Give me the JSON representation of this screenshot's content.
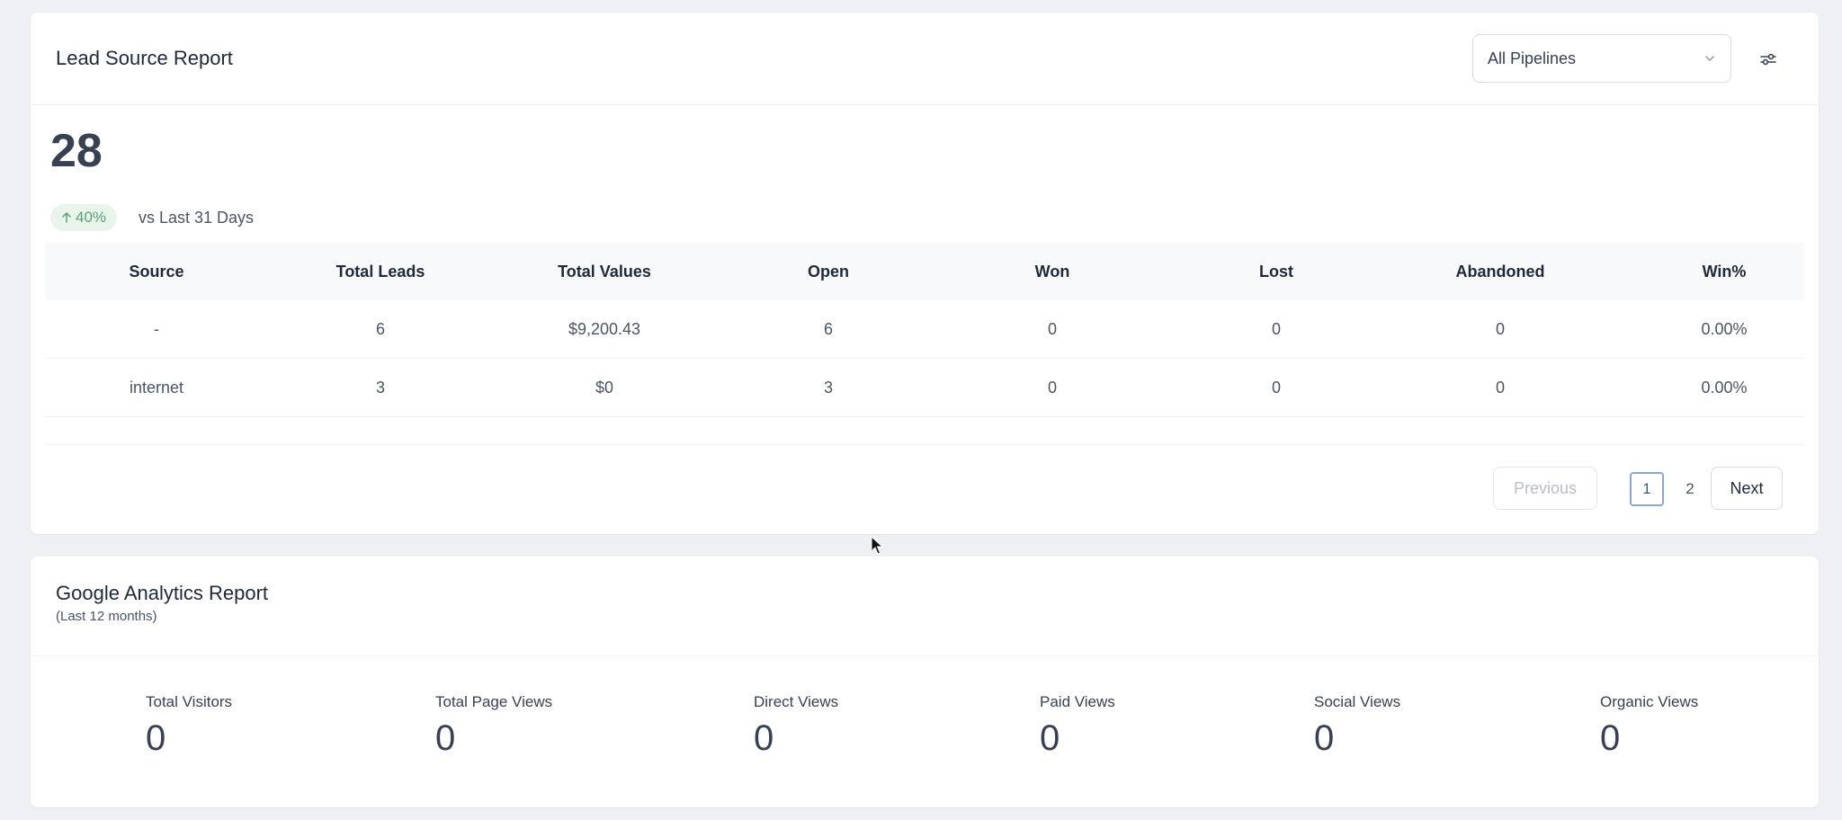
{
  "lead_report": {
    "title": "Lead Source Report",
    "pipeline_select": "All Pipelines",
    "total": "28",
    "trend_percent": "40%",
    "trend_text": "vs Last 31 Days",
    "columns": [
      "Source",
      "Total Leads",
      "Total Values",
      "Open",
      "Won",
      "Lost",
      "Abandoned",
      "Win%"
    ],
    "rows": [
      [
        "-",
        "6",
        "$9,200.43",
        "6",
        "0",
        "0",
        "0",
        "0.00%"
      ],
      [
        "internet",
        "3",
        "$0",
        "3",
        "0",
        "0",
        "0",
        "0.00%"
      ]
    ],
    "pagination": {
      "previous": "Previous",
      "pages": [
        "1",
        "2"
      ],
      "next": "Next"
    }
  },
  "ga_report": {
    "title": "Google Analytics Report",
    "subtitle": "(Last 12 months)",
    "metrics": [
      {
        "label": "Total Visitors",
        "value": "0"
      },
      {
        "label": "Total Page Views",
        "value": "0"
      },
      {
        "label": "Direct Views",
        "value": "0"
      },
      {
        "label": "Paid Views",
        "value": "0"
      },
      {
        "label": "Social Views",
        "value": "0"
      },
      {
        "label": "Organic Views",
        "value": "0"
      }
    ]
  },
  "icons": {
    "chevron": "chevron-down-icon",
    "filter": "sliders-icon",
    "trend": "arrow-up-icon",
    "cursor": "mouse-cursor-icon"
  },
  "colors": {
    "trend_badge_bg": "#e8f4ec",
    "trend_badge_text": "#5aa06f",
    "active_page_border": "#8fa6c7"
  }
}
